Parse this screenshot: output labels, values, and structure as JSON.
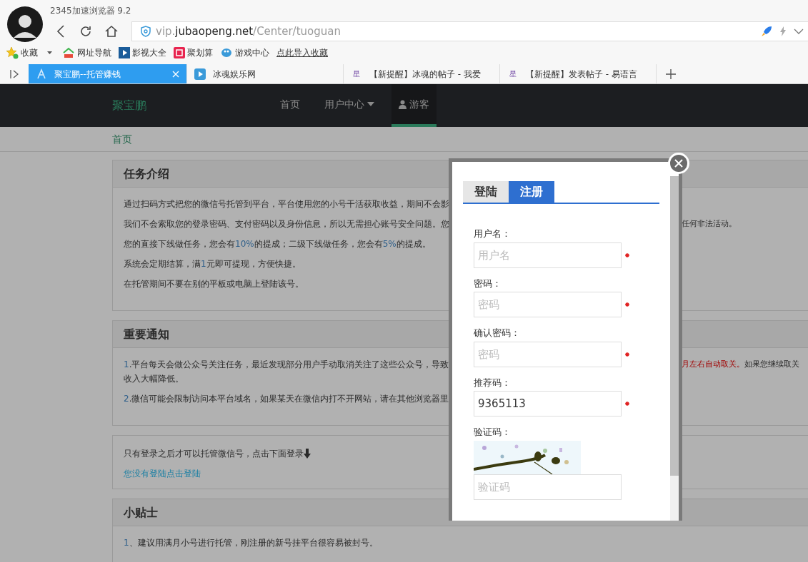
{
  "browser": {
    "title": "2345加速浏览器 9.2",
    "address": [
      {
        "kind": "muted",
        "text": "vip."
      },
      {
        "kind": "domain",
        "text": "jubaopeng.net"
      },
      {
        "kind": "muted",
        "text": "/Center/tuoguan"
      }
    ],
    "bookmarks": [
      {
        "kind": "favorites",
        "label": "收藏"
      },
      {
        "kind": "house",
        "label": "网址导航"
      },
      {
        "kind": "film",
        "label": "影视大全"
      },
      {
        "kind": "deal",
        "label": "聚划算"
      },
      {
        "kind": "game",
        "label": "游戏中心"
      },
      {
        "kind": "link",
        "label": "点此导入收藏"
      }
    ],
    "tabs": [
      {
        "label": "聚宝鹏--托管赚钱",
        "selected": true,
        "kind": "logo"
      },
      {
        "label": "冰魂娱乐网",
        "selected": false,
        "kind": "play"
      },
      {
        "label": "【新提醒】冰魂的帖子 - 我爱",
        "selected": false,
        "kind": "char",
        "favicon": "星"
      },
      {
        "label": "【新提醒】发表帖子 - 易语言",
        "selected": false,
        "kind": "char",
        "favicon": "星"
      }
    ]
  },
  "site": {
    "logo": "聚宝鹏",
    "nav": [
      {
        "label": "首页",
        "kind": "plain",
        "selected": false
      },
      {
        "label": "用户中心",
        "kind": "dropdown",
        "selected": false
      },
      {
        "label": "游客",
        "kind": "user",
        "selected": true
      }
    ],
    "breadcrumb": "首页"
  },
  "panels": [
    {
      "title": "任务介绍",
      "lines": [
        {
          "segments": [
            {
              "kind": "text",
              "text": "通过扫码方式把您的微信号托管到平台，平台使用您的小号干活获取收益，期间不会影"
            }
          ]
        },
        {
          "segments": [
            {
              "kind": "text",
              "text": "我们不会索取您的登录密码、支付密码以及身份信息，所以无需担心账号安全问题。您"
            }
          ],
          "tail": [
            {
              "kind": "text",
              "text": "任何非法活动。"
            }
          ]
        },
        {
          "segments": [
            {
              "kind": "text",
              "text": "您的直接下线做任务，您会有"
            },
            {
              "kind": "number",
              "text": "10%"
            },
            {
              "kind": "text",
              "text": "的提成；二级下线做任务，您会有"
            },
            {
              "kind": "number",
              "text": "5%"
            },
            {
              "kind": "text",
              "text": "的提成。"
            }
          ]
        },
        {
          "segments": [
            {
              "kind": "text",
              "text": "系统会定期结算，满"
            },
            {
              "kind": "number",
              "text": "1"
            },
            {
              "kind": "text",
              "text": "元即可提现，方便快捷。"
            }
          ]
        },
        {
          "segments": [
            {
              "kind": "text",
              "text": "在托管期间不要在别的平板或电脑上登陆该号。"
            }
          ]
        }
      ]
    },
    {
      "title": "重要通知",
      "lines": [
        {
          "segments": [
            {
              "kind": "number",
              "text": "1"
            },
            {
              "kind": "text",
              "text": ".平台每天会做公众号关注任务，最近发现部分用户手动取消关注了这些公众号，导致"
            }
          ],
          "tail": [
            {
              "kind": "alert",
              "text": "月左右自动取关。"
            },
            {
              "kind": "text",
              "text": "如果您继续取关"
            }
          ],
          "next": "收入大幅降低。"
        },
        {
          "segments": [
            {
              "kind": "number",
              "text": "2"
            },
            {
              "kind": "text",
              "text": ".微信可能会限制访问本平台域名，如果某天在微信内打不开网站，请在其他浏览器里"
            }
          ]
        }
      ]
    },
    {
      "lines": [
        {
          "segments": [
            {
              "kind": "text",
              "text": "只有登录之后才可以托管微信号，点击下面登录"
            }
          ],
          "arrow": true
        }
      ],
      "link": "您没有登陆点击登陆"
    },
    {
      "title": "小贴士",
      "lines": [
        {
          "segments": [
            {
              "kind": "number",
              "text": "1"
            },
            {
              "kind": "text",
              "text": "、建议用满月小号进行托管，刚注册的新号挂平台很容易被封号。"
            }
          ]
        }
      ]
    }
  ],
  "modal": {
    "tabs": [
      {
        "label": "登陆",
        "selected": false
      },
      {
        "label": "注册",
        "selected": true
      }
    ],
    "fields": [
      {
        "kind": "input",
        "label": "用户名：",
        "placeholder": "用户名",
        "required": true
      },
      {
        "kind": "input",
        "label": "密码：",
        "placeholder": "密码",
        "required": true
      },
      {
        "kind": "input",
        "label": "确认密码：",
        "placeholder": "密码",
        "required": true
      },
      {
        "kind": "input",
        "label": "推荐码：",
        "value": "9365113",
        "required": true
      },
      {
        "kind": "captcha",
        "label": "验证码：",
        "placeholder": "验证码",
        "required": false
      }
    ]
  }
}
